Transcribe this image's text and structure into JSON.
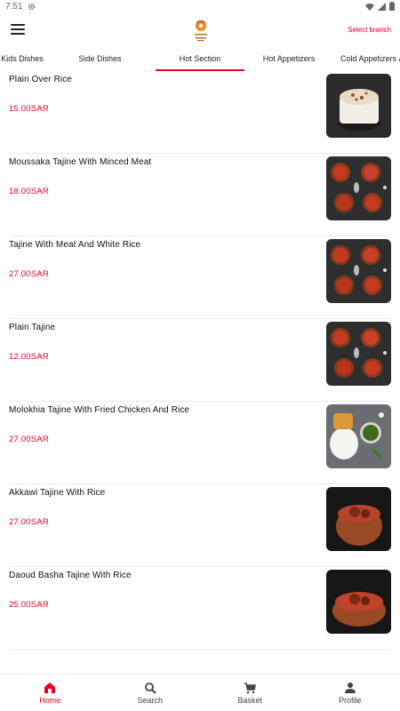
{
  "status_bar": {
    "time": "7:51"
  },
  "header": {
    "select_branch": "Select branch"
  },
  "tabs": [
    {
      "label": "Kids Dishes",
      "active": false
    },
    {
      "label": "Side Dishes",
      "active": false
    },
    {
      "label": "Hot Section",
      "active": true
    },
    {
      "label": "Hot Appetizers",
      "active": false
    },
    {
      "label": "Cold Appetizers &",
      "active": false
    }
  ],
  "items": [
    {
      "name": "Plain Over Rice",
      "price": "15.00SAR",
      "image": "rice-bowl"
    },
    {
      "name": "Moussaka Tajine With Minced Meat",
      "price": "18.00SAR",
      "image": "tajine-pots"
    },
    {
      "name": "Tajine With Meat And White Rice",
      "price": "27.00SAR",
      "image": "tajine-pots"
    },
    {
      "name": "Plain Tajine",
      "price": "12.00SAR",
      "image": "tajine-pots"
    },
    {
      "name": "Molokhia Tajine With Fried Chicken And Rice",
      "price": "27.00SAR",
      "image": "molokhia-plate"
    },
    {
      "name": "Akkawi Tajine With Rice",
      "price": "27.00SAR",
      "image": "clay-pot"
    },
    {
      "name": "Daoud Basha Tajine With Rice",
      "price": "25.00SAR",
      "image": "clay-pot"
    }
  ],
  "bottom_nav": [
    {
      "label": "Home",
      "icon": "home-icon",
      "active": true
    },
    {
      "label": "Search",
      "icon": "search-icon",
      "active": false
    },
    {
      "label": "Basket",
      "icon": "basket-icon",
      "active": false
    },
    {
      "label": "Profile",
      "icon": "profile-icon",
      "active": false
    }
  ],
  "colors": {
    "accent": "#e3002b",
    "text": "#111111",
    "divider": "#ebebeb"
  }
}
